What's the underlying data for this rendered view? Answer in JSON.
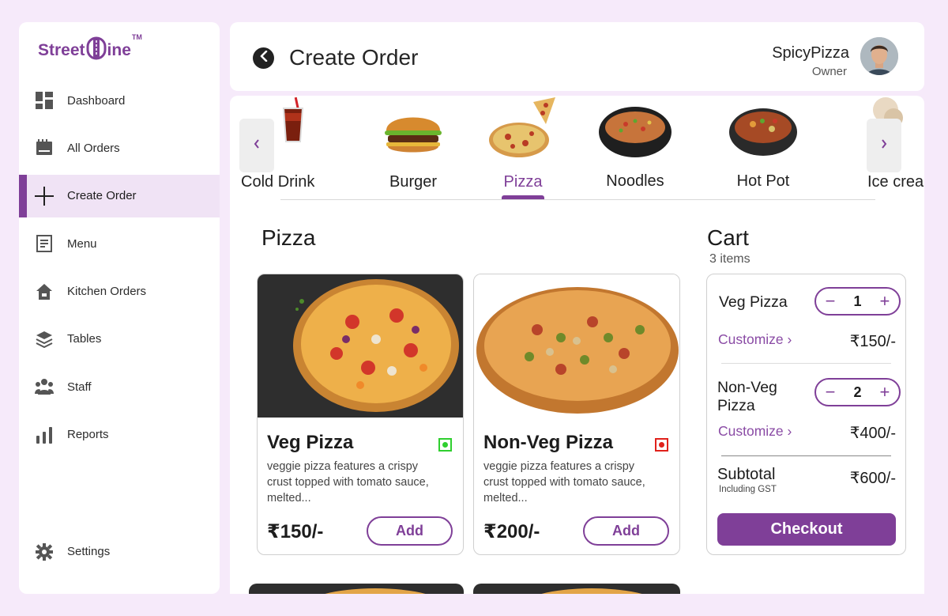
{
  "brand": {
    "name_part1": "Street",
    "name_part2": "ine",
    "tm": "TM"
  },
  "sidebar": {
    "items": [
      {
        "label": "Dashboard",
        "icon": "dashboard-icon"
      },
      {
        "label": "All Orders",
        "icon": "orders-icon"
      },
      {
        "label": "Create Order",
        "icon": "plus-icon",
        "active": true
      },
      {
        "label": "Menu",
        "icon": "menu-icon"
      },
      {
        "label": "Kitchen Orders",
        "icon": "kitchen-icon"
      },
      {
        "label": "Tables",
        "icon": "layers-icon"
      },
      {
        "label": "Staff",
        "icon": "staff-icon"
      },
      {
        "label": "Reports",
        "icon": "reports-icon"
      }
    ],
    "settings_label": "Settings"
  },
  "header": {
    "title": "Create Order",
    "user_name": "SpicyPizza",
    "user_role": "Owner"
  },
  "categories": [
    {
      "label": "Cold Drink"
    },
    {
      "label": "Burger"
    },
    {
      "label": "Pizza",
      "active": true
    },
    {
      "label": "Noodles"
    },
    {
      "label": "Hot  Pot"
    },
    {
      "label": "Ice cream"
    }
  ],
  "section": {
    "title": "Pizza"
  },
  "products": [
    {
      "name": "Veg Pizza",
      "type": "veg",
      "description": "veggie pizza features a crispy crust topped with tomato sauce, melted...",
      "price": "₹150/-",
      "add_label": "Add"
    },
    {
      "name": "Non-Veg Pizza",
      "type": "non-veg",
      "description": "veggie pizza features a crispy crust topped with tomato sauce, melted...",
      "price": "₹200/-",
      "add_label": "Add"
    }
  ],
  "cart": {
    "title": "Cart",
    "count_label": "3 items",
    "items": [
      {
        "name": "Veg Pizza",
        "qty": "1",
        "customize_label": "Customize ›",
        "price": "₹150/-"
      },
      {
        "name_line1": "Non-Veg",
        "name_line2": "Pizza",
        "qty": "2",
        "customize_label": "Customize ›",
        "price": "₹400/-"
      }
    ],
    "subtotal_label": "Subtotal",
    "subtotal_note": "Including GST",
    "subtotal_value": "₹600/-",
    "checkout_label": "Checkout"
  },
  "colors": {
    "accent": "#7f3f98",
    "background": "#f6eafa",
    "veg": "#2fcf2f",
    "non_veg": "#e0211b"
  }
}
